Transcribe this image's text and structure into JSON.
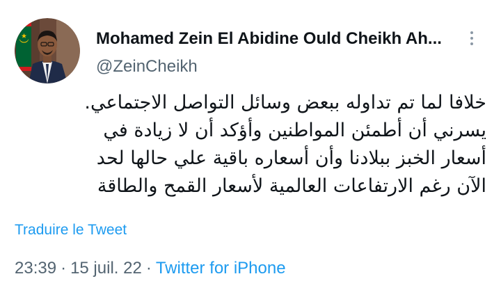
{
  "author": {
    "display_name": "Mohamed Zein El Abidine Ould Cheikh Ah...",
    "handle": "@ZeinCheikh"
  },
  "tweet": {
    "lines": [
      "خلافا لما تم تداوله ببعض وسائل التواصل الاجتماعي.",
      "يسرني أن أطمئن المواطنين وأؤكد أن لا زيادة في",
      "أسعار الخبز ببلادنا وأن أسعاره باقية علي حالها لحد",
      "الآن رغم الارتفاعات العالمية لأسعار القمح والطاقة"
    ],
    "translate_label": "Traduire le Tweet",
    "time": "23:39",
    "separator": "·",
    "date": "15 juil. 22",
    "source": "Twitter for iPhone"
  },
  "colors": {
    "link": "#1d9bf0",
    "secondary": "#536471",
    "text": "#0f1419",
    "flag_green": "#006233",
    "flag_gold": "#ffc400",
    "flag_red": "#d01c1f"
  },
  "icons": {
    "more": "more-vertical-icon"
  }
}
